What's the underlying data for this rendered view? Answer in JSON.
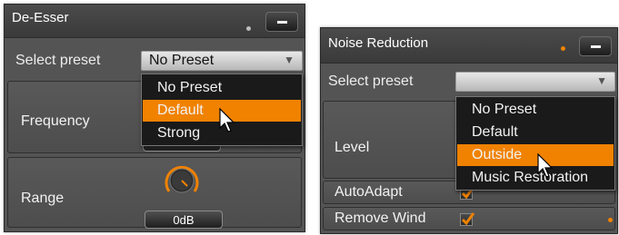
{
  "colors": {
    "accent": "#f08200",
    "panel": "#545454",
    "menu_bg": "#1a1a1a"
  },
  "left_panel": {
    "title": "De-Esser",
    "status_icon": "dot-indicator-icon",
    "minimize_icon": "minus-icon",
    "preset_label": "Select preset",
    "preset_value": "No Preset",
    "dropdown_icon": "chevron-down-icon",
    "menu_items": [
      {
        "label": "No Preset",
        "highlighted": false
      },
      {
        "label": "Default",
        "highlighted": true
      },
      {
        "label": "Strong",
        "highlighted": false
      }
    ],
    "frequency_label": "Frequency",
    "range_label": "Range",
    "range_value": "0dB",
    "knob_icon": "knob-icon"
  },
  "right_panel": {
    "title": "Noise Reduction",
    "status_icon": "dot-indicator-icon",
    "minimize_icon": "minus-icon",
    "preset_label": "Select preset",
    "preset_value": "",
    "dropdown_icon": "chevron-down-icon",
    "menu_items": [
      {
        "label": "No Preset",
        "highlighted": false
      },
      {
        "label": "Default",
        "highlighted": false
      },
      {
        "label": "Outside",
        "highlighted": true
      },
      {
        "label": "Music Restoration",
        "highlighted": false
      }
    ],
    "level_label": "Level",
    "autoadapt_label": "AutoAdapt",
    "autoadapt_checked": true,
    "remove_wind_label": "Remove Wind",
    "remove_wind_checked": true
  }
}
